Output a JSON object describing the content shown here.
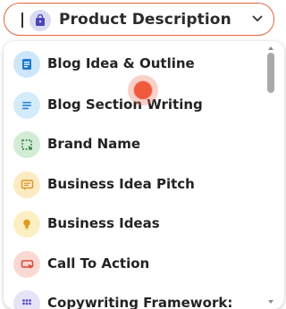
{
  "select": {
    "value": "Product Description",
    "icon": "bag-icon",
    "accent": "#e0643f"
  },
  "options": [
    {
      "label": "Blog Idea & Outline",
      "icon": "doc-icon",
      "bg": "#cde6fa",
      "fg": "#1f78d1"
    },
    {
      "label": "Blog Section Writing",
      "icon": "lines-icon",
      "bg": "#d4ebfa",
      "fg": "#2a86d6"
    },
    {
      "label": "Brand Name",
      "icon": "frame-icon",
      "bg": "#d3ecd6",
      "fg": "#2f7a3a"
    },
    {
      "label": "Business Idea Pitch",
      "icon": "chat-icon",
      "bg": "#fcebc2",
      "fg": "#d8982a"
    },
    {
      "label": "Business Ideas",
      "icon": "bulb-icon",
      "bg": "#fdefc4",
      "fg": "#e39a1d"
    },
    {
      "label": "Call To Action",
      "icon": "cta-icon",
      "bg": "#fbd8d2",
      "fg": "#d44a3a"
    },
    {
      "label": "Copywriting Framework:",
      "icon": "grid-icon",
      "bg": "#e6e3f6",
      "fg": "#5a4fc4"
    }
  ]
}
